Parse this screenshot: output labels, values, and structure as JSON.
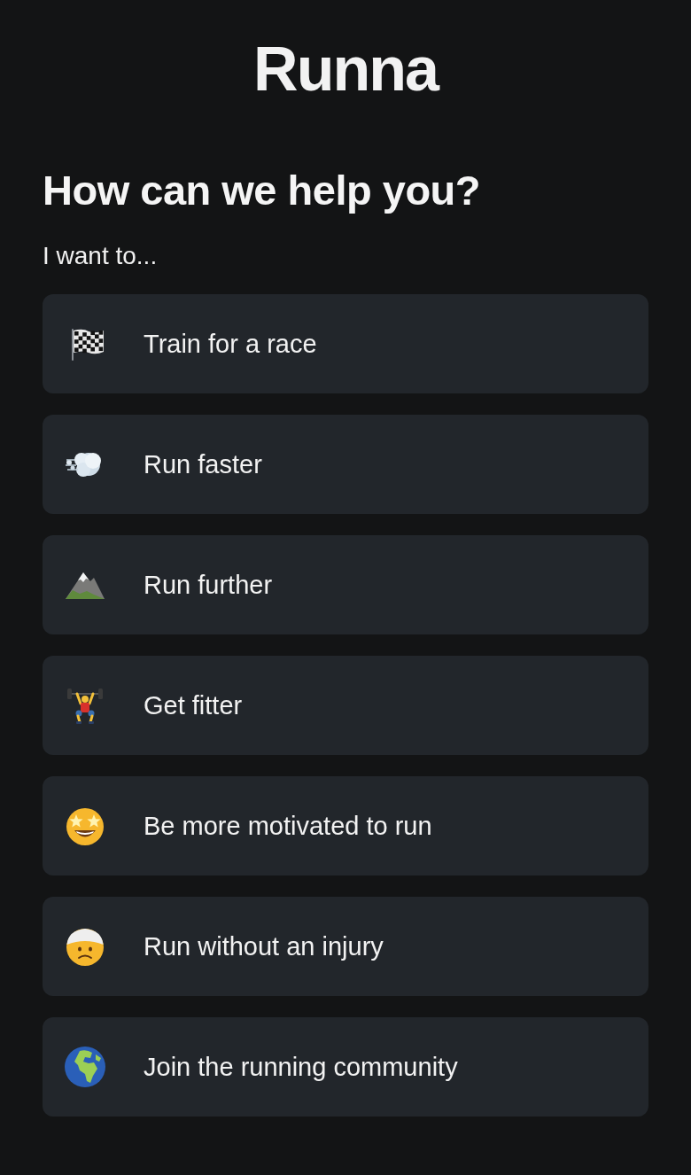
{
  "logo": {
    "text": "Runna"
  },
  "heading": "How can we help you?",
  "prompt": "I want to...",
  "options": [
    {
      "kind": "flag",
      "label": "Train for a race"
    },
    {
      "kind": "dash",
      "label": "Run faster"
    },
    {
      "kind": "mountain",
      "label": "Run further"
    },
    {
      "kind": "weightlifter",
      "label": "Get fitter"
    },
    {
      "kind": "starstruck",
      "label": "Be more motivated to run"
    },
    {
      "kind": "bandaged",
      "label": "Run without an injury"
    },
    {
      "kind": "globe",
      "label": "Join the running community"
    }
  ]
}
